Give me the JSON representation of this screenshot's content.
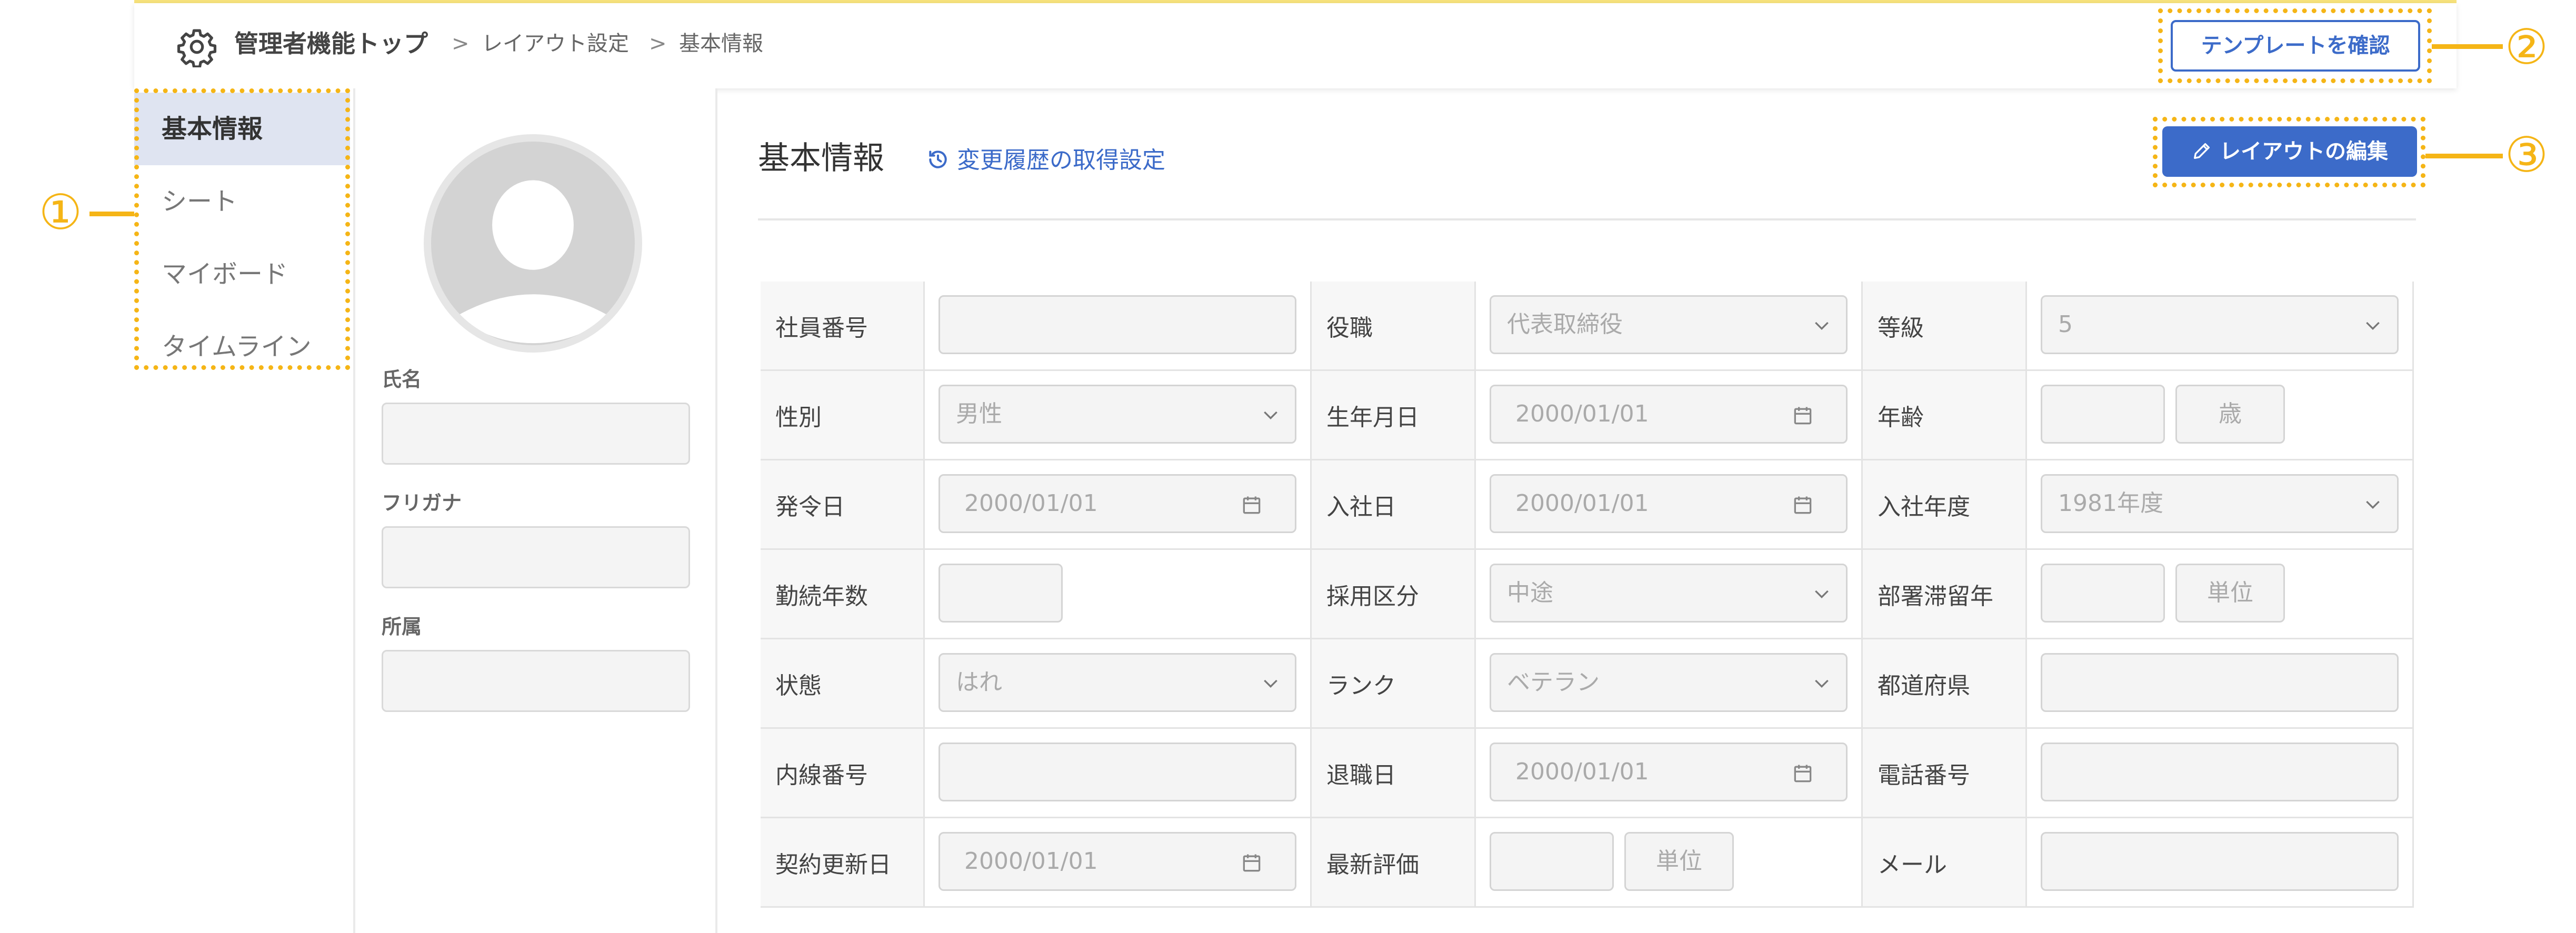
{
  "breadcrumb": {
    "top": "管理者機能トップ",
    "sep": ">",
    "layout": "レイアウト設定",
    "current": "基本情報"
  },
  "header": {
    "template_button": "テンプレートを確認"
  },
  "sidebar": {
    "items": [
      {
        "label": "基本情報",
        "active": true
      },
      {
        "label": "シート",
        "active": false
      },
      {
        "label": "マイボード",
        "active": false
      },
      {
        "label": "タイムライン",
        "active": false
      }
    ]
  },
  "profile": {
    "name_label": "氏名",
    "furigana_label": "フリガナ",
    "dept_label": "所属"
  },
  "main": {
    "title": "基本情報",
    "history_link": "変更履歴の取得設定",
    "edit_button": "レイアウトの編集"
  },
  "fields": {
    "r0c0": {
      "label": "社員番号"
    },
    "r0c1": {
      "label": "役職",
      "value": "代表取締役"
    },
    "r0c2": {
      "label": "等級",
      "value": "5"
    },
    "r1c0": {
      "label": "性別",
      "value": "男性"
    },
    "r1c1": {
      "label": "生年月日",
      "value": "2000/01/01"
    },
    "r1c2": {
      "label": "年齢",
      "unit": "歳"
    },
    "r2c0": {
      "label": "発令日",
      "value": "2000/01/01"
    },
    "r2c1": {
      "label": "入社日",
      "value": "2000/01/01"
    },
    "r2c2": {
      "label": "入社年度",
      "value": "1981年度"
    },
    "r3c0": {
      "label": "勤続年数"
    },
    "r3c1": {
      "label": "採用区分",
      "value": "中途"
    },
    "r3c2": {
      "label": "部署滞留年",
      "unit": "単位"
    },
    "r4c0": {
      "label": "状態",
      "value": "はれ"
    },
    "r4c1": {
      "label": "ランク",
      "value": "ベテラン"
    },
    "r4c2": {
      "label": "都道府県"
    },
    "r5c0": {
      "label": "内線番号"
    },
    "r5c1": {
      "label": "退職日",
      "value": "2000/01/01"
    },
    "r5c2": {
      "label": "電話番号"
    },
    "r6c0": {
      "label": "契約更新日",
      "value": "2000/01/01"
    },
    "r6c1": {
      "label": "最新評価",
      "unit": "単位"
    },
    "r6c2": {
      "label": "メール"
    }
  },
  "annotations": {
    "n1": "①",
    "n2": "②",
    "n3": "③"
  },
  "colors": {
    "accent": "#3c6bc9",
    "annotation": "#f5b516",
    "active_bg": "#dfe4f1"
  }
}
